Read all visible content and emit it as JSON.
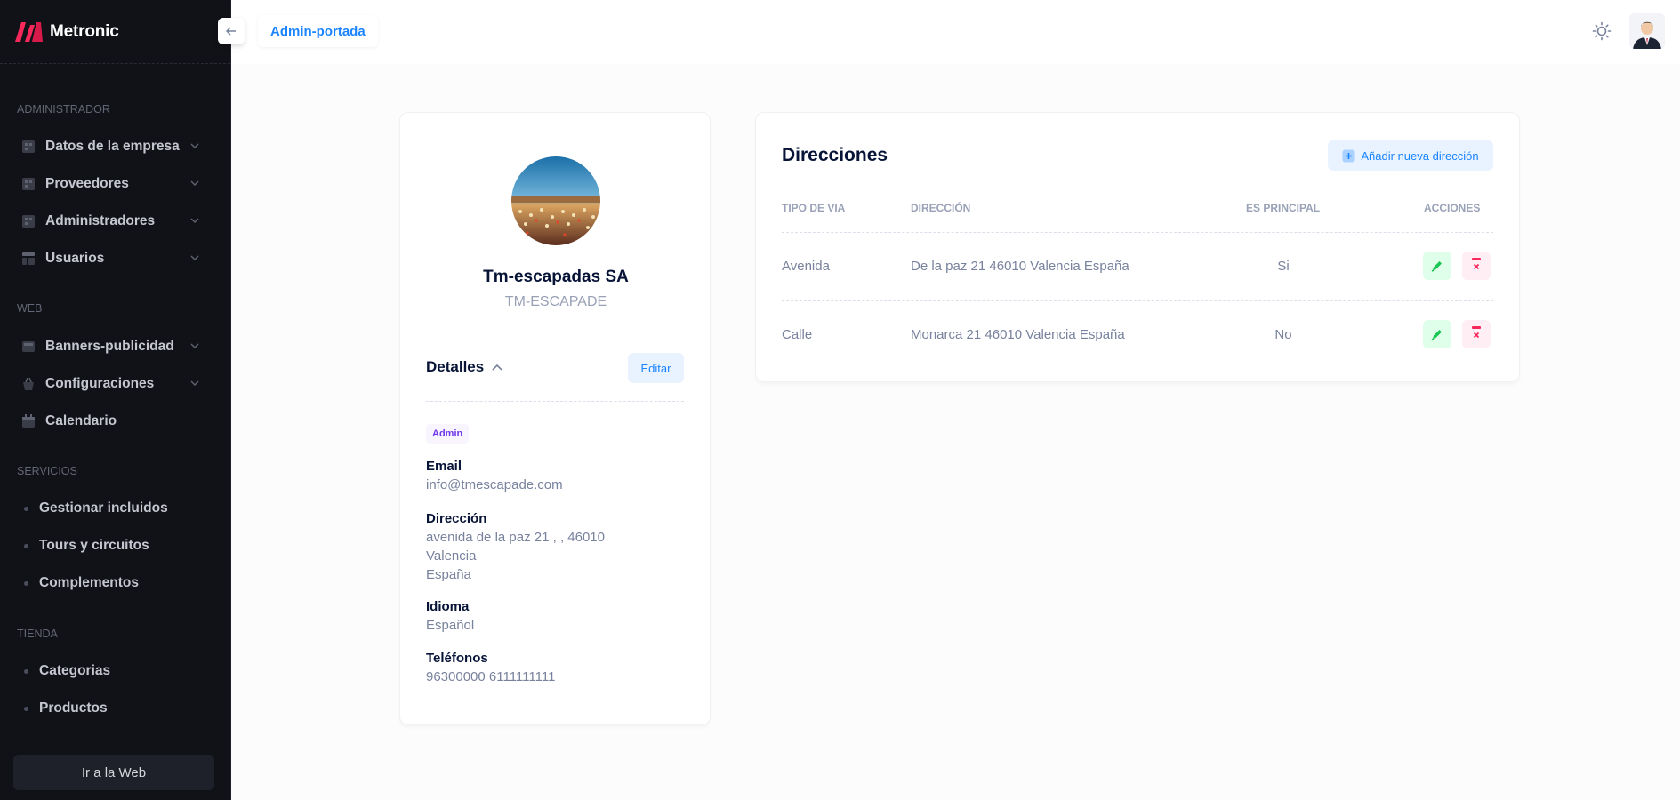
{
  "app": {
    "brand": "Metronic"
  },
  "sidebar": {
    "sections": [
      {
        "title": "ADMINISTRADOR"
      },
      {
        "title": "WEB"
      },
      {
        "title": "SERVICIOS"
      },
      {
        "title": "TIENDA"
      }
    ],
    "items": [
      {
        "label": "Datos de la empresa",
        "icon": "building-icon"
      },
      {
        "label": "Proveedores",
        "icon": "building-icon"
      },
      {
        "label": "Administradores",
        "icon": "building-icon"
      },
      {
        "label": "Usuarios",
        "icon": "layout-icon"
      },
      {
        "label": "Banners-publicidad",
        "icon": "banner-icon"
      },
      {
        "label": "Configuraciones",
        "icon": "basket-icon"
      },
      {
        "label": "Calendario",
        "icon": "calendar-icon"
      },
      {
        "label": "Gestionar incluidos"
      },
      {
        "label": "Tours y circuitos"
      },
      {
        "label": "Complementos"
      },
      {
        "label": "Categorias"
      },
      {
        "label": "Productos"
      }
    ],
    "footer_button": "Ir a la Web"
  },
  "header": {
    "breadcrumb": "Admin-portada"
  },
  "profile": {
    "name": "Tm-escapadas SA",
    "code": "TM-ESCAPADE",
    "details_title": "Detalles",
    "edit_label": "Editar",
    "badge": "Admin",
    "fields": {
      "email_label": "Email",
      "email_value": "info@tmescapade.com",
      "address_label": "Dirección",
      "address_line1": "avenida de la paz 21 , , 46010",
      "address_line2": "Valencia",
      "address_line3": "España",
      "language_label": "Idioma",
      "language_value": "Español",
      "phones_label": "Teléfonos",
      "phones_value": "96300000 6111111111"
    }
  },
  "addresses": {
    "title": "Direcciones",
    "add_label": "Añadir nueva dirección",
    "columns": [
      "TIPO DE VIA",
      "DIRECCIÓN",
      "ES PRINCIPAL",
      "ACCIONES"
    ],
    "rows": [
      {
        "tipo": "Avenida",
        "direccion": "De la paz 21 46010 Valencia España",
        "principal": "Si"
      },
      {
        "tipo": "Calle",
        "direccion": "Monarca 21 46010 Valencia España",
        "principal": "No"
      }
    ]
  },
  "colors": {
    "accent": "#1b84ff",
    "sidebar_bg": "#111217",
    "success_bg": "#dfffea",
    "success": "#17c653",
    "danger_bg": "#ffeef3",
    "danger": "#f8285a"
  }
}
